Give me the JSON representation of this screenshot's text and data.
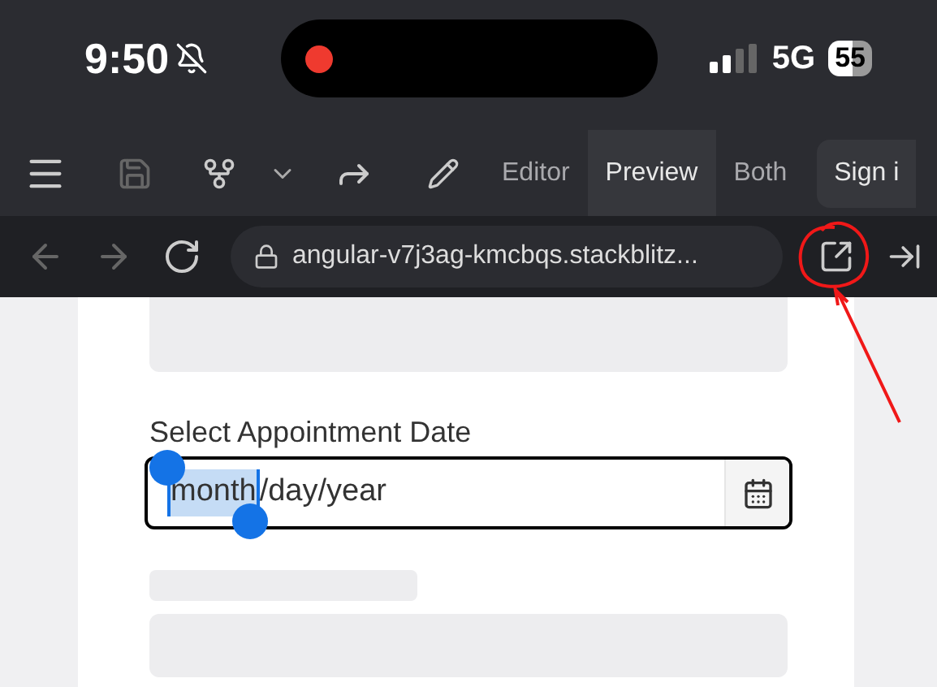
{
  "status_bar": {
    "time": "9:50",
    "recording": true,
    "network": "5G",
    "battery": "55"
  },
  "toolbar": {
    "tabs": [
      {
        "label": "Editor",
        "selected": false
      },
      {
        "label": "Preview",
        "selected": true
      },
      {
        "label": "Both",
        "selected": false
      }
    ],
    "sign_in": "Sign i"
  },
  "address_bar": {
    "url": "angular-v7j3ag-kmcbqs.stackblitz..."
  },
  "form": {
    "label": "Select Appointment Date",
    "date_field": {
      "focused": true,
      "segments": [
        {
          "text": "month",
          "selected": true
        },
        {
          "text": "/day/year",
          "selected": false
        }
      ]
    }
  }
}
